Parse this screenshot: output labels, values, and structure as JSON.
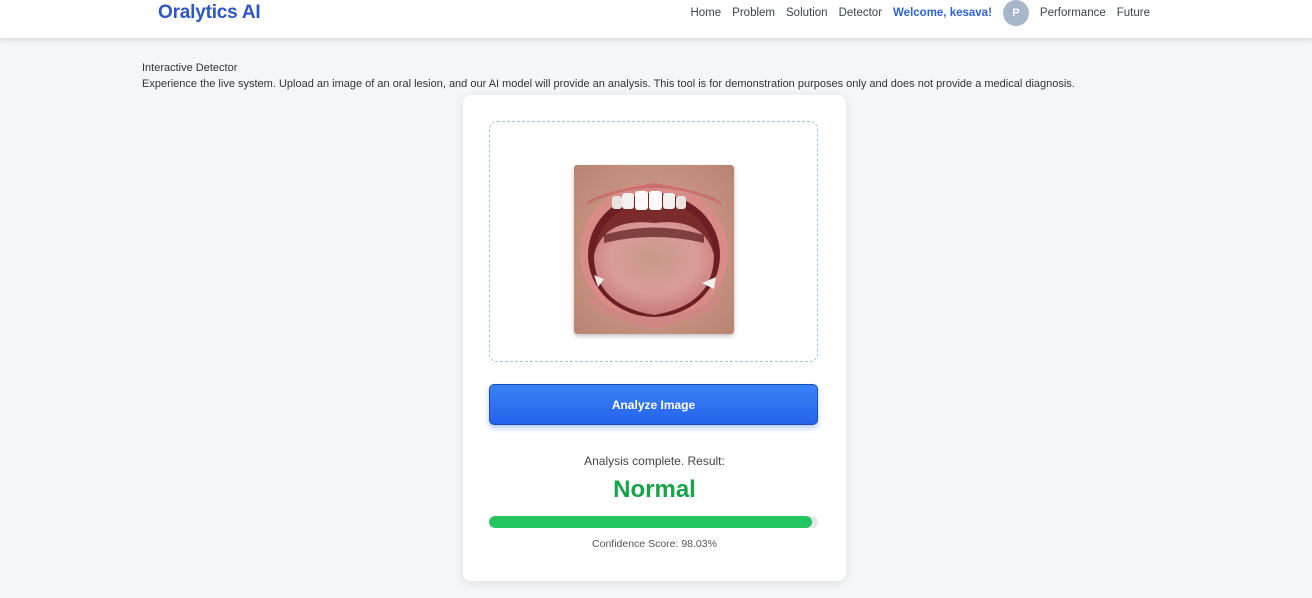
{
  "header": {
    "brand": "Oralytics AI",
    "nav": {
      "home": "Home",
      "problem": "Problem",
      "solution": "Solution",
      "detector": "Detector",
      "welcome": "Welcome, kesava!",
      "avatar_initial": "P",
      "performance": "Performance",
      "future": "Future"
    }
  },
  "section": {
    "title": "Interactive Detector",
    "description": "Experience the live system. Upload an image of an oral lesion, and our AI model will provide an analysis. This tool is for demonstration purposes only and does not provide a medical diagnosis."
  },
  "detector": {
    "preview_icon": "uploaded-mouth-image",
    "analyze_label": "Analyze Image",
    "result_label": "Analysis complete. Result:",
    "result_value": "Normal",
    "confidence_fraction": 0.9803,
    "confidence_text": "Confidence Score: 98.03%"
  },
  "colors": {
    "brand": "#2d56c9",
    "accent": "#2563eb",
    "result": "#16a34a",
    "confidence_bar": "#22c55e"
  }
}
